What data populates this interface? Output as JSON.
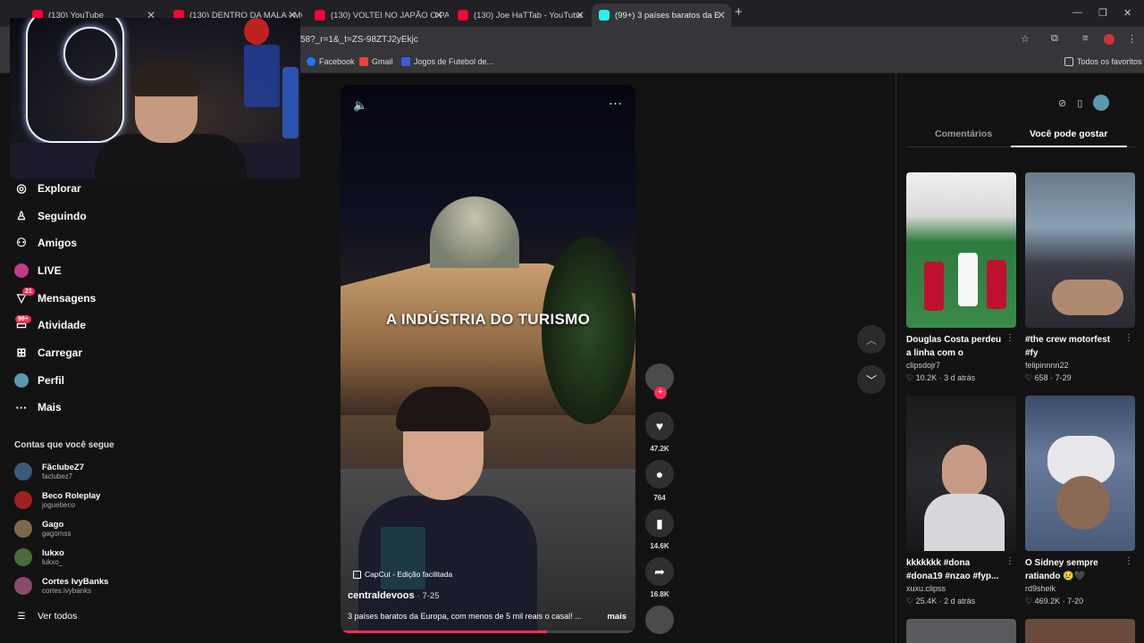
{
  "tabs": [
    {
      "title": "(130) YouTube",
      "color": "#ff0033"
    },
    {
      "title": "(130) DENTRO DA MALA - MC",
      "color": "#ff0033"
    },
    {
      "title": "(130) VOLTEI NO JAPÃO O PAÍS",
      "color": "#ff0033"
    },
    {
      "title": "(130) Joe HaTTab - YouTube",
      "color": "#ff0033"
    },
    {
      "title": "(99+) 3 países baratos da E",
      "color": "#25f4ee"
    }
  ],
  "new_tab": "+",
  "address": {
    "url": "58?_r=1&_t=ZS-98ZTJ2yEkjc"
  },
  "bookmarks": [
    "Facebook",
    "Gmail",
    "Jogos de Futebol de...",
    "Todos os favoritos"
  ],
  "sidebar": {
    "items": [
      {
        "label": "Explorar",
        "icon": "compass-icon"
      },
      {
        "label": "Seguindo",
        "icon": "user-follow-icon"
      },
      {
        "label": "Amigos",
        "icon": "friends-icon"
      },
      {
        "label": "LIVE",
        "icon": "live-icon"
      },
      {
        "label": "Mensagens",
        "icon": "messages-icon",
        "badge": "21"
      },
      {
        "label": "Atividade",
        "icon": "activity-icon",
        "badge": "99+"
      },
      {
        "label": "Carregar",
        "icon": "upload-icon"
      },
      {
        "label": "Perfil",
        "icon": "avatar"
      },
      {
        "label": "Mais",
        "icon": "more-icon"
      }
    ],
    "following_title": "Contas que você segue",
    "accounts": [
      {
        "name": "FãclubeZ7",
        "handle": "faclubez7",
        "color": "#3a5a7a"
      },
      {
        "name": "Beco Roleplay",
        "handle": "joguebeco",
        "color": "#a02020"
      },
      {
        "name": "Gago",
        "handle": "gagomss",
        "color": "#7a6a4a"
      },
      {
        "name": "lukxo",
        "handle": "lukxo_",
        "color": "#4a6a3a"
      },
      {
        "name": "Cortes IvyBanks",
        "handle": "cortes.ivybanks",
        "color": "#8a4a6a"
      }
    ],
    "see_all": "Ver todos"
  },
  "video": {
    "caption": "A INDÚSTRIA DO TURISMO",
    "capcut": "CapCut - Edição facilitada",
    "author": "centraldevoos",
    "date": "· 7-25",
    "description": "3 países baratos da Europa, com menos de 5 mil reais o casal! ...",
    "more": "mais",
    "progress": 0.7
  },
  "actions": {
    "likes": "47.2K",
    "comments": "764",
    "saves": "14.6K",
    "shares": "16.8K"
  },
  "right_panel": {
    "tab_comments": "Comentários",
    "tab_suggested": "Você pode gostar",
    "cards": [
      {
        "title": "Douglas Costa perdeu a linha com o Juninho?!...",
        "user": "clipsdojr7",
        "stats": "♡ 10.2K · 3 d atrás"
      },
      {
        "title": "#the crew motorfest #fy",
        "user": "felipinnnn22",
        "stats": "♡ 658 · 7-29"
      },
      {
        "title": "kkkkkkk #dona #dona19 #nzao #fyp...",
        "user": "xuxu.clipss",
        "stats": "♡ 25.4K · 2 d atrás"
      },
      {
        "title": "O Sidney sempre ratiando 😢🖤",
        "user": "rd9sheik",
        "stats": "♡ 469.2K · 7-20"
      }
    ]
  }
}
